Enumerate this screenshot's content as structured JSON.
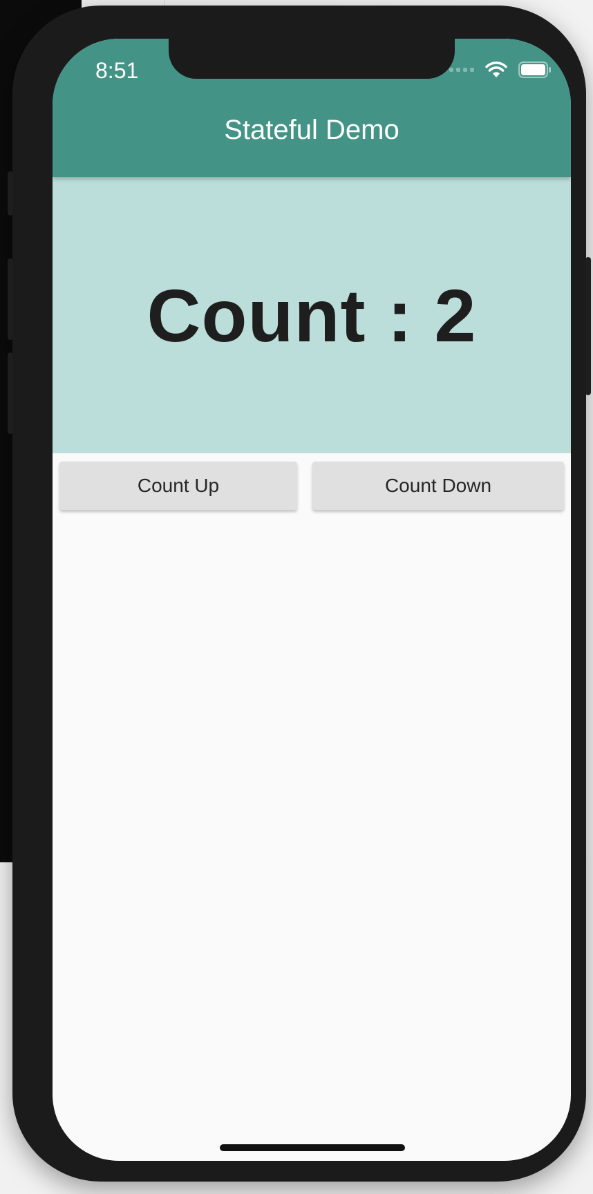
{
  "status_bar": {
    "time": "8:51",
    "signal_icon": "cellular-signal-icon",
    "wifi_icon": "wifi-icon",
    "battery_icon": "battery-icon"
  },
  "app_bar": {
    "title": "Stateful Demo",
    "color": "#439486"
  },
  "counter": {
    "text": "Count : 2",
    "panel_color": "#bcdeda"
  },
  "buttons": {
    "count_up_label": "Count Up",
    "count_down_label": "Count Down"
  }
}
